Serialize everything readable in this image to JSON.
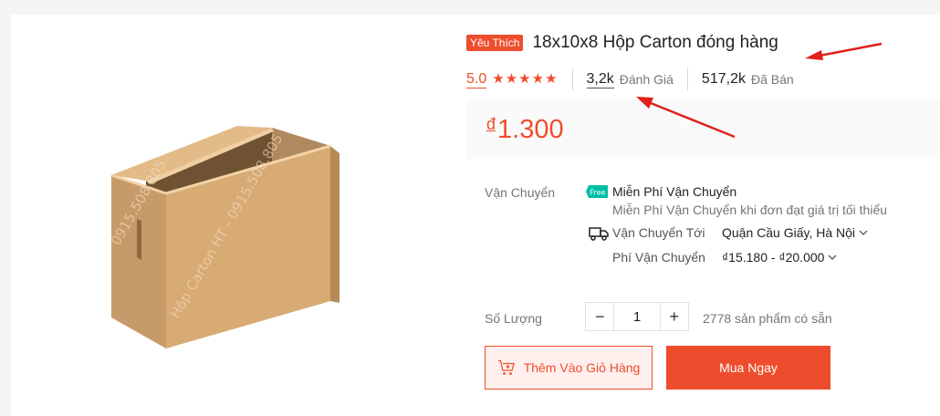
{
  "colors": {
    "accent": "#ee4d2d",
    "annotation_arrow": "#e0201b",
    "free_badge": "#00bfa5"
  },
  "product": {
    "badge": "Yêu Thích",
    "title": "18x10x8 Hộp Carton đóng hàng",
    "image_icon": "cardboard-box-image"
  },
  "rating": {
    "score": "5.0",
    "stars": 5,
    "review_count": "3,2k",
    "review_label": "Đánh Giá",
    "sold_count": "517,2k",
    "sold_label": "Đã Bán"
  },
  "price": {
    "currency": "đ",
    "value": "1.300"
  },
  "shipping": {
    "label": "Vận Chuyển",
    "free_icon_text": "Free",
    "free_title": "Miễn Phí Vận Chuyển",
    "free_desc": "Miễn Phí Vận Chuyển khi đơn đạt giá trị tối thiểu",
    "ship_to_label": "Vận Chuyển Tới",
    "ship_to_value": "Quận Cầu Giấy, Hà Nội",
    "fee_label": "Phí Vận Chuyển",
    "fee_value": "₫15.180 - ₫20.000"
  },
  "quantity": {
    "label": "Số Lượng",
    "minus": "−",
    "value": "1",
    "plus": "+",
    "stock": "2778 sản phẩm có sẵn"
  },
  "actions": {
    "add_to_cart": "Thêm Vào Giỏ Hàng",
    "buy_now": "Mua Ngay"
  }
}
